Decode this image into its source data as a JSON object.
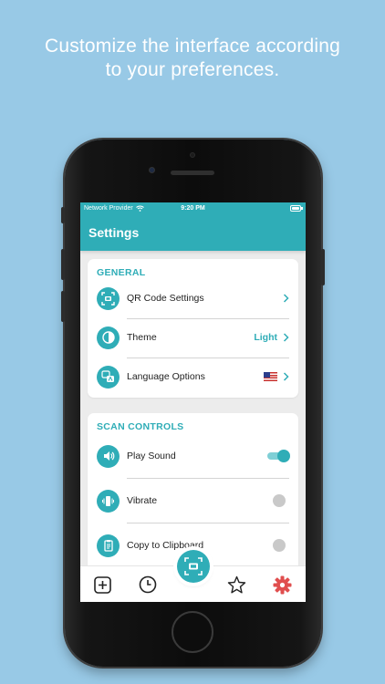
{
  "headline": {
    "line1": "Customize the interface according",
    "line2": "to your preferences."
  },
  "status_bar": {
    "carrier": "Network Provider",
    "time": "9:20 PM"
  },
  "app_bar": {
    "title": "Settings"
  },
  "general": {
    "title": "GENERAL",
    "items": [
      {
        "label": "QR Code Settings",
        "value": "",
        "icon": "qr-settings-icon"
      },
      {
        "label": "Theme",
        "value": "Light",
        "icon": "theme-icon"
      },
      {
        "label": "Language Options",
        "value": "",
        "icon": "language-icon",
        "flag": "us-flag"
      }
    ]
  },
  "scan_controls": {
    "title": "SCAN CONTROLS",
    "items": [
      {
        "label": "Play Sound",
        "icon": "speaker-icon",
        "enabled": true
      },
      {
        "label": "Vibrate",
        "icon": "vibrate-icon",
        "enabled": false
      },
      {
        "label": "Copy to Clipboard",
        "icon": "clipboard-icon",
        "enabled": false
      }
    ]
  },
  "bottom_nav": {
    "items": [
      "create",
      "history",
      "scan",
      "favorites",
      "settings"
    ],
    "active": "settings"
  },
  "colors": {
    "accent": "#2fadb7",
    "background": "#98c9e6",
    "active_nav": "#e04e4e"
  }
}
